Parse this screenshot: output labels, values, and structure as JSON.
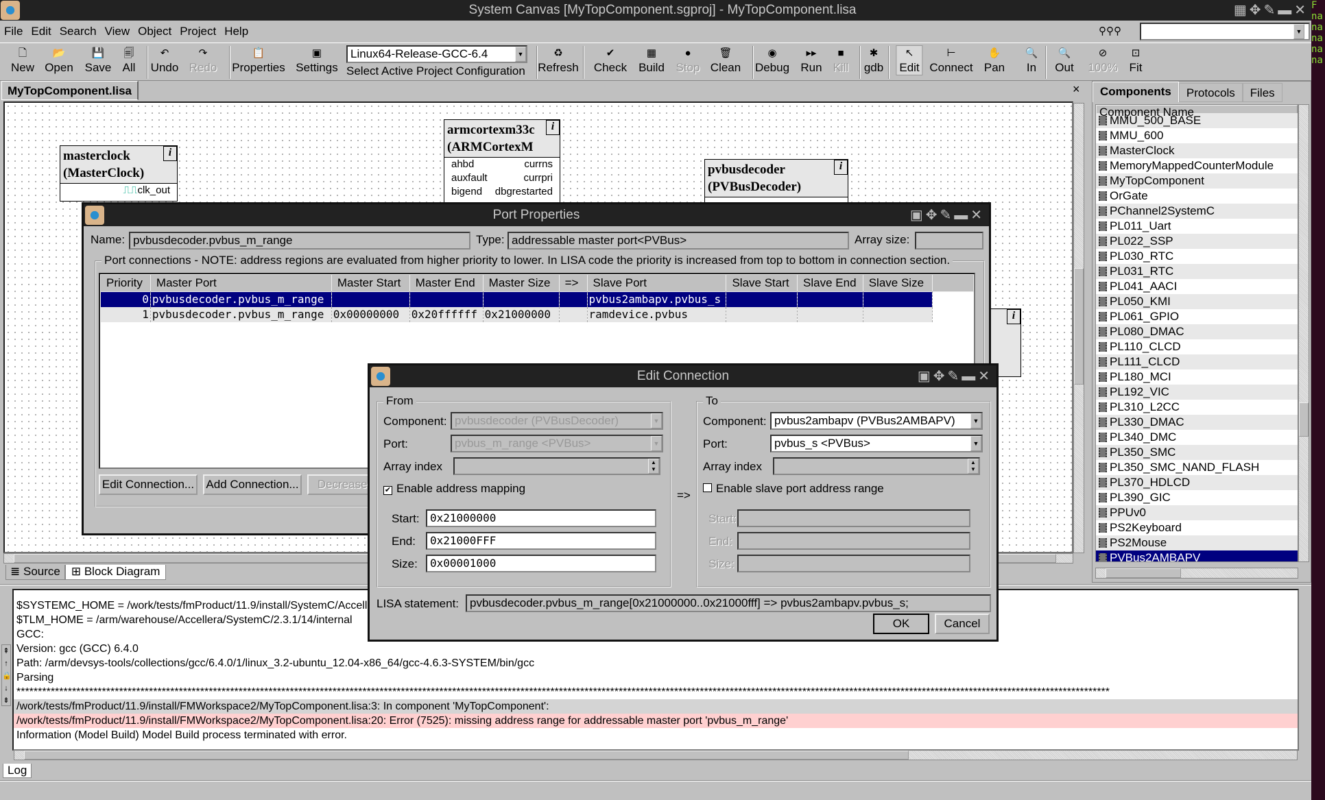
{
  "window": {
    "title": "System Canvas [MyTopComponent.sgproj] - MyTopComponent.lisa"
  },
  "menu": [
    "File",
    "Edit",
    "Search",
    "View",
    "Object",
    "Project",
    "Help"
  ],
  "toolbar": {
    "buttons": [
      {
        "label": "New",
        "icon": "new-file-icon",
        "glyph": "🗋",
        "disabled": false
      },
      {
        "label": "Open",
        "icon": "open-folder-icon",
        "glyph": "📂",
        "disabled": false
      },
      {
        "label": "Save",
        "icon": "save-icon",
        "glyph": "💾",
        "disabled": false
      },
      {
        "label": "All",
        "icon": "save-all-icon",
        "glyph": "🗐",
        "disabled": false
      },
      {
        "label": "Undo",
        "icon": "undo-icon",
        "glyph": "↶",
        "disabled": false
      },
      {
        "label": "Redo",
        "icon": "redo-icon",
        "glyph": "↷",
        "disabled": true
      },
      {
        "label": "Properties",
        "icon": "properties-icon",
        "glyph": "📋",
        "disabled": false
      },
      {
        "label": "Settings",
        "icon": "settings-icon",
        "glyph": "▣",
        "disabled": false
      },
      {
        "label": "Refresh",
        "icon": "refresh-icon",
        "glyph": "♻",
        "disabled": false
      },
      {
        "label": "Check",
        "icon": "check-icon",
        "glyph": "✔",
        "disabled": false
      },
      {
        "label": "Build",
        "icon": "build-icon",
        "glyph": "▦",
        "disabled": false
      },
      {
        "label": "Stop",
        "icon": "stop-icon",
        "glyph": "●",
        "disabled": true
      },
      {
        "label": "Clean",
        "icon": "clean-icon",
        "glyph": "🗑",
        "disabled": false
      },
      {
        "label": "Debug",
        "icon": "debug-icon",
        "glyph": "◉",
        "disabled": false
      },
      {
        "label": "Run",
        "icon": "run-icon",
        "glyph": "▸▸",
        "disabled": false
      },
      {
        "label": "Kill",
        "icon": "kill-icon",
        "glyph": "■",
        "disabled": true
      },
      {
        "label": "gdb",
        "icon": "gdb-bug-icon",
        "glyph": "✱",
        "disabled": false
      },
      {
        "label": "Edit",
        "icon": "pointer-icon",
        "glyph": "↖",
        "disabled": false,
        "active": true
      },
      {
        "label": "Connect",
        "icon": "connect-icon",
        "glyph": "⊢",
        "disabled": false
      },
      {
        "label": "Pan",
        "icon": "hand-icon",
        "glyph": "✋",
        "disabled": false
      },
      {
        "label": "In",
        "icon": "zoom-in-icon",
        "glyph": "🔍",
        "disabled": false
      },
      {
        "label": "Out",
        "icon": "zoom-out-icon",
        "glyph": "🔍",
        "disabled": false
      },
      {
        "label": "100%",
        "icon": "zoom-reset-icon",
        "glyph": "⊘",
        "disabled": true
      },
      {
        "label": "Fit",
        "icon": "zoom-fit-icon",
        "glyph": "⊡",
        "disabled": false
      }
    ],
    "config_value": "Linux64-Release-GCC-6.4",
    "config_label": "Select Active Project Configuration",
    "search_value": ""
  },
  "document_tab": "MyTopComponent.lisa",
  "close_glyph": "×",
  "canvas": {
    "blocks": [
      {
        "name": "masterclock",
        "type": "(MasterClock)",
        "ports": [
          [
            "",
            "clk_out"
          ]
        ]
      },
      {
        "name": "armcortexm33c",
        "type": "(ARMCortexM",
        "ports": [
          [
            "ahbd",
            "currns"
          ],
          [
            "auxfault",
            "currpri"
          ],
          [
            "bigend",
            "dbgrestarted"
          ]
        ]
      },
      {
        "name": "pvbusdecoder",
        "type": "(PVBusDecoder)",
        "ports": []
      }
    ],
    "info_glyph": "i",
    "bottom_tabs": [
      "Source",
      "Block Diagram"
    ]
  },
  "components_panel": {
    "tabs": [
      "Components",
      "Protocols",
      "Files"
    ],
    "header": "Component Name",
    "items": [
      "MMU_500_BASE",
      "MMU_600",
      "MasterClock",
      "MemoryMappedCounterModule",
      "MyTopComponent",
      "OrGate",
      "PChannel2SystemC",
      "PL011_Uart",
      "PL022_SSP",
      "PL030_RTC",
      "PL031_RTC",
      "PL041_AACI",
      "PL050_KMI",
      "PL061_GPIO",
      "PL080_DMAC",
      "PL110_CLCD",
      "PL111_CLCD",
      "PL180_MCI",
      "PL192_VIC",
      "PL310_L2CC",
      "PL330_DMAC",
      "PL340_DMC",
      "PL350_SMC",
      "PL350_SMC_NAND_FLASH",
      "PL370_HDLCD",
      "PL390_GIC",
      "PPUv0",
      "PS2Keyboard",
      "PS2Mouse",
      "PVBus2AMBAPV"
    ],
    "selected": "PVBus2AMBAPV"
  },
  "log": {
    "tab": "Log",
    "lines": [
      {
        "text": "$SYSTEMC_HOME = /work/tests/fmProduct/11.9/install/SystemC/Accellera/SystemC",
        "kind": "plain"
      },
      {
        "text": "$TLM_HOME = /arm/warehouse/Accellera/SystemC/2.3.1/14/internal",
        "kind": "plain"
      },
      {
        "text": "GCC:",
        "kind": "plain"
      },
      {
        "text": "Version: gcc (GCC) 6.4.0",
        "kind": "plain"
      },
      {
        "text": "Path: /arm/devsys-tools/collections/gcc/6.4.0/1/linux_3.2-ubuntu_12.04-x86_64/gcc-4.6.3-SYSTEM/bin/gcc",
        "kind": "plain"
      },
      {
        "text": "Parsing",
        "kind": "plain"
      },
      {
        "text": "****************************************************************************************************************************************************************************************************************************************************************",
        "kind": "plain"
      },
      {
        "text": "/work/tests/fmProduct/11.9/install/FMWorkspace2/MyTopComponent.lisa:3: In component 'MyTopComponent':",
        "kind": "info"
      },
      {
        "text": "/work/tests/fmProduct/11.9/install/FMWorkspace2/MyTopComponent.lisa:20: Error (7525): missing address range for addressable master port 'pvbus_m_range'",
        "kind": "err"
      },
      {
        "text": "Information (Model Build) Model Build process terminated with error.",
        "kind": "plain"
      }
    ]
  },
  "port_properties": {
    "title": "Port Properties",
    "name_label": "Name:",
    "name_value": "pvbusdecoder.pvbus_m_range",
    "type_label": "Type:",
    "type_value": "addressable master port<PVBus>",
    "array_size_label": "Array size:",
    "array_size_value": "",
    "group_label": "Port connections - NOTE: address regions are evaluated from higher priority to lower. In LISA code the priority is increased from top to bottom in connection section.",
    "columns": [
      "Priority",
      "Master Port",
      "Master Start",
      "Master End",
      "Master Size",
      "=>",
      "Slave Port",
      "Slave Start",
      "Slave End",
      "Slave Size"
    ],
    "rows": [
      [
        "0",
        "pvbusdecoder.pvbus_m_range",
        "",
        "",
        "",
        "",
        "pvbus2ambapv.pvbus_s",
        "",
        "",
        ""
      ],
      [
        "1",
        "pvbusdecoder.pvbus_m_range",
        "0x00000000",
        "0x20ffffff",
        "0x21000000",
        "",
        "ramdevice.pvbus",
        "",
        "",
        ""
      ]
    ],
    "buttons": {
      "edit": "Edit Connection...",
      "add": "Add Connection...",
      "decrease": "Decrease Priority"
    }
  },
  "edit_connection": {
    "title": "Edit Connection",
    "from": {
      "label": "From",
      "component_label": "Component:",
      "component_value": "pvbusdecoder (PVBusDecoder)",
      "port_label": "Port:",
      "port_value": "pvbus_m_range <PVBus>",
      "array_index_label": "Array index",
      "array_index_value": "",
      "enable_label": "Enable address mapping",
      "enabled": true,
      "start_label": "Start:",
      "start_value": "0x21000000",
      "end_label": "End:",
      "end_value": "0x21000FFF",
      "size_label": "Size:",
      "size_value": "0x00001000"
    },
    "arrow": "=>",
    "to": {
      "label": "To",
      "component_label": "Component:",
      "component_value": "pvbus2ambapv (PVBus2AMBAPV)",
      "port_label": "Port:",
      "port_value": "pvbus_s <PVBus>",
      "array_index_label": "Array index",
      "array_index_value": "",
      "enable_label": "Enable slave port address range",
      "enabled": false,
      "start_label": "Start:",
      "start_value": "",
      "end_label": "End:",
      "end_value": "",
      "size_label": "Size:",
      "size_value": ""
    },
    "lisa_label": "LISA statement:",
    "lisa_value": "pvbusdecoder.pvbus_m_range[0x21000000..0x21000fff] => pvbus2ambapv.pvbus_s;",
    "ok": "OK",
    "cancel": "Cancel"
  },
  "colors": {
    "selection": "#000080",
    "error_row": "#ffd0d0",
    "titlebar": "#222222",
    "face": "#c0c0c0"
  }
}
